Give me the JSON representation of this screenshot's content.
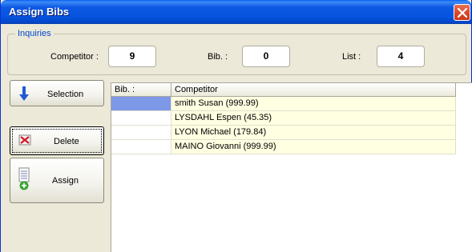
{
  "window": {
    "title": "Assign Bibs"
  },
  "inquiries": {
    "legend": "Inquiries",
    "competitor_label": "Competitor :",
    "competitor_value": "9",
    "bib_label": "Bib. :",
    "bib_value": "0",
    "list_label": "List :",
    "list_value": "4"
  },
  "buttons": {
    "selection": "Selection",
    "delete": "Delete",
    "assign": "Assign"
  },
  "grid": {
    "columns": [
      "Bib. :",
      "Competitor"
    ],
    "rows": [
      {
        "bib": "",
        "competitor": "smith Susan (999.99)"
      },
      {
        "bib": "",
        "competitor": "LYSDAHL Espen (45.35)"
      },
      {
        "bib": "",
        "competitor": "LYON Michael (179.84)"
      },
      {
        "bib": "",
        "competitor": "MAINO Giovanni (999.99)"
      }
    ]
  },
  "icons": {
    "close": "close-icon",
    "selection": "arrow-down-icon",
    "delete": "delete-x-icon",
    "assign": "list-add-icon"
  },
  "colors": {
    "titlebar": "#0653df",
    "close_button": "#d94a2c",
    "legend_text": "#0046d5",
    "row_background": "#ffffe1",
    "selected_cell": "#7e98e8"
  }
}
